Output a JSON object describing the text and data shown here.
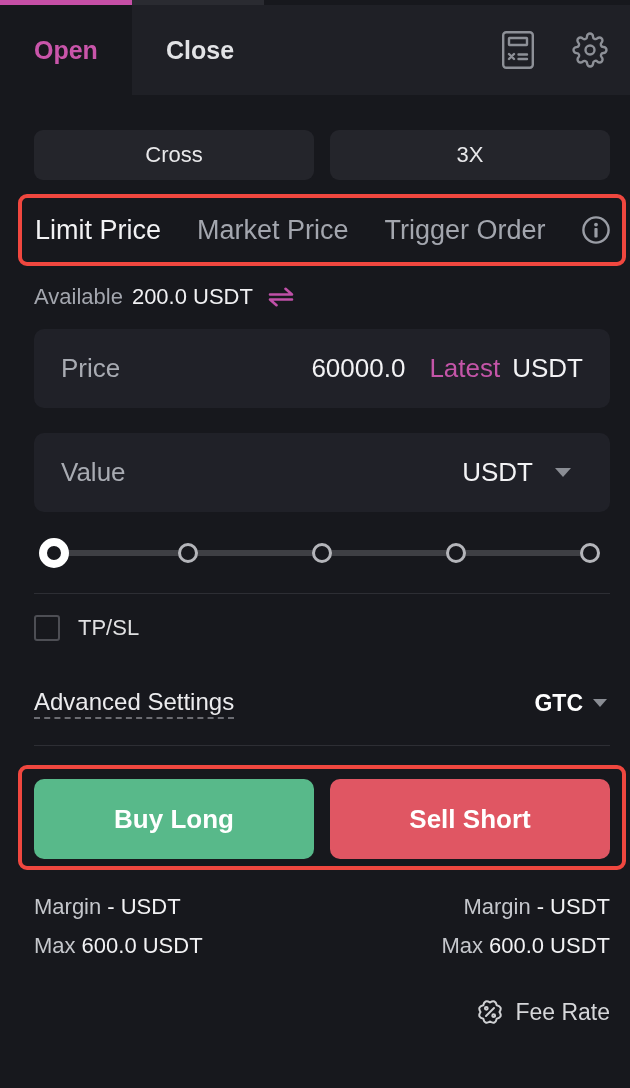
{
  "header": {
    "tabs": [
      {
        "label": "Open",
        "selected": true
      },
      {
        "label": "Close",
        "selected": false
      }
    ]
  },
  "margin_mode": {
    "mode": "Cross",
    "leverage": "3X"
  },
  "order_types": {
    "highlighted": true,
    "tabs": [
      {
        "label": "Limit Price",
        "selected": true
      },
      {
        "label": "Market Price",
        "selected": false
      },
      {
        "label": "Trigger Order",
        "selected": false
      }
    ]
  },
  "available": {
    "label": "Available",
    "value": "200.0 USDT"
  },
  "price_field": {
    "label": "Price",
    "value": "60000.0",
    "latest": "Latest",
    "unit": "USDT"
  },
  "value_field": {
    "label": "Value",
    "unit": "USDT"
  },
  "slider": {
    "level": 0
  },
  "tpsl": {
    "label": "TP/SL",
    "checked": false
  },
  "advanced": {
    "label": "Advanced Settings",
    "time_in_force": "GTC"
  },
  "actions": {
    "highlighted": true,
    "buttons": [
      {
        "label": "Buy Long",
        "kind": "buy"
      },
      {
        "label": "Sell Short",
        "kind": "sell"
      }
    ]
  },
  "summary": {
    "buy": [
      {
        "label": "Margin",
        "value": "- USDT"
      },
      {
        "label": "Max",
        "value": "600.0 USDT"
      }
    ],
    "sell": [
      {
        "label": "Margin",
        "value": "- USDT"
      },
      {
        "label": "Max",
        "value": "600.0 USDT"
      }
    ]
  },
  "fee_rate": {
    "label": "Fee Rate"
  }
}
